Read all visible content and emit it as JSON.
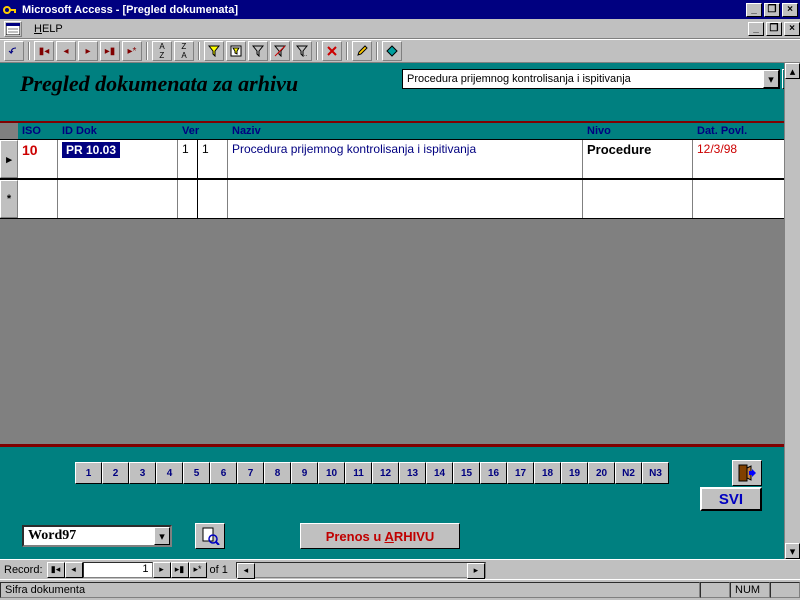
{
  "title": "Microsoft Access - [Pregled dokumenata]",
  "menu": {
    "help": "HELP"
  },
  "form": {
    "title": "Pregled dokumenata za arhivu",
    "doc_name": "Procedura prijemnog kontrolisanja i ispitivanja"
  },
  "columns": {
    "iso": "ISO",
    "iddok": "ID Dok",
    "ver": "Ver",
    "naziv": "Naziv",
    "nivo": "Nivo",
    "datpovl": "Dat. Povl."
  },
  "row": {
    "iso": "10",
    "iddok": "PR 10.03",
    "ver1": "1",
    "ver2": "1",
    "naziv": "Procedura prijemnog kontrolisanja i ispitivanja",
    "nivo": "Procedure",
    "dat": "12/3/98"
  },
  "numbtns": [
    "1",
    "2",
    "3",
    "4",
    "5",
    "6",
    "7",
    "8",
    "9",
    "10",
    "11",
    "12",
    "13",
    "14",
    "15",
    "16",
    "17",
    "18",
    "19",
    "20",
    "N2",
    "N3"
  ],
  "svi": "SVI",
  "word_combo": "Word97",
  "prenos": "Prenos u ARHIVU",
  "record": {
    "label": "Record:",
    "current": "1",
    "of": "of ",
    "total": "1"
  },
  "status": {
    "text": "Sifra dokumenta",
    "num": "NUM"
  }
}
